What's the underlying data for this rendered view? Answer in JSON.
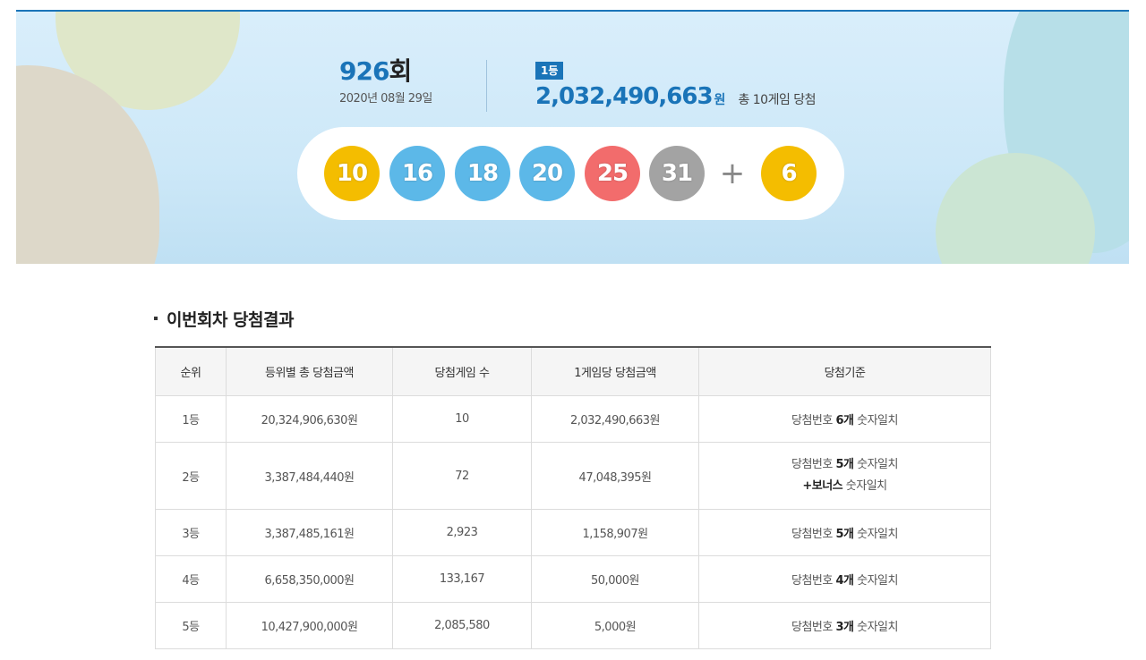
{
  "draw": {
    "round_number": "926",
    "round_suffix": "회",
    "date": "2020년 08월 29일"
  },
  "first_prize": {
    "badge": "1등",
    "amount": "2,032,490,663",
    "unit": "원",
    "winners_text": "총 10게임 당첨"
  },
  "balls": [
    {
      "number": "10",
      "color": "#f4bd00"
    },
    {
      "number": "16",
      "color": "#5cb8e8"
    },
    {
      "number": "18",
      "color": "#5cb8e8"
    },
    {
      "number": "20",
      "color": "#5cb8e8"
    },
    {
      "number": "25",
      "color": "#f26c6c"
    },
    {
      "number": "31",
      "color": "#a3a3a3"
    }
  ],
  "bonus": {
    "symbol": "+",
    "number": "6",
    "color": "#f4bd00"
  },
  "results": {
    "title": "이번회차 당첨결과",
    "headers": [
      "순위",
      "등위별 총 당첨금액",
      "당첨게임 수",
      "1게임당 당첨금액",
      "당첨기준"
    ],
    "rows": [
      {
        "rank": "1등",
        "total": "20,324,906,630원",
        "games": "10",
        "per_game": "2,032,490,663원",
        "criteria_pre": "당첨번호 ",
        "criteria_bold": "6개",
        "criteria_post": " 숫자일치",
        "criteria_extra_bold": "",
        "criteria_extra_post": ""
      },
      {
        "rank": "2등",
        "total": "3,387,484,440원",
        "games": "72",
        "per_game": "47,048,395원",
        "criteria_pre": "당첨번호 ",
        "criteria_bold": "5개",
        "criteria_post": " 숫자일치",
        "criteria_extra_bold": "+보너스",
        "criteria_extra_post": " 숫자일치"
      },
      {
        "rank": "3등",
        "total": "3,387,485,161원",
        "games": "2,923",
        "per_game": "1,158,907원",
        "criteria_pre": "당첨번호 ",
        "criteria_bold": "5개",
        "criteria_post": " 숫자일치",
        "criteria_extra_bold": "",
        "criteria_extra_post": ""
      },
      {
        "rank": "4등",
        "total": "6,658,350,000원",
        "games": "133,167",
        "per_game": "50,000원",
        "criteria_pre": "당첨번호 ",
        "criteria_bold": "4개",
        "criteria_post": " 숫자일치",
        "criteria_extra_bold": "",
        "criteria_extra_post": ""
      },
      {
        "rank": "5등",
        "total": "10,427,900,000원",
        "games": "2,085,580",
        "per_game": "5,000원",
        "criteria_pre": "당첨번호 ",
        "criteria_bold": "3개",
        "criteria_post": " 숫자일치",
        "criteria_extra_bold": "",
        "criteria_extra_post": ""
      }
    ]
  }
}
